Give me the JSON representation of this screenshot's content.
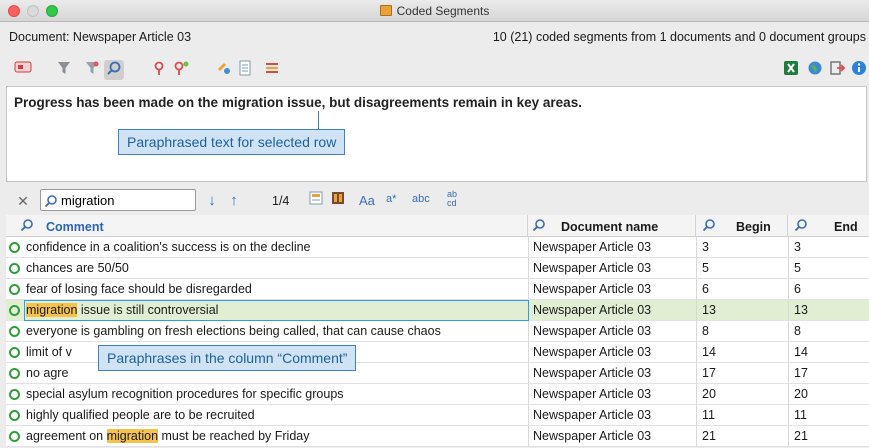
{
  "window": {
    "title": "Coded Segments"
  },
  "document_label": "Document: Newspaper Article 03",
  "segments_summary": "10 (21) coded segments from 1 documents and 0 document groups",
  "preview_text": "Progress has been made on the migration issue, but disagreements remain in key areas.",
  "callouts": {
    "top": "Paraphrased text for selected row",
    "bottom": "Paraphrases in the column “Comment”"
  },
  "search": {
    "value": "migration",
    "position": "1/4",
    "match_case": "Aa",
    "wildcard": "a*",
    "whole_word": "abc",
    "replace": "ab cd"
  },
  "columns": {
    "comment": "Comment",
    "document": "Document name",
    "begin": "Begin",
    "end": "End"
  },
  "rows": [
    {
      "comment": "confidence in a coalition's success is on the decline",
      "document": "Newspaper Article 03",
      "begin": "3",
      "end": "3"
    },
    {
      "comment": "chances are 50/50",
      "document": "Newspaper Article 03",
      "begin": "5",
      "end": "5"
    },
    {
      "comment": "fear of losing face should be disregarded",
      "document": "Newspaper Article 03",
      "begin": "6",
      "end": "6"
    },
    {
      "comment_hl": "migration",
      "comment_after": " issue is still controversial",
      "document": "Newspaper Article 03",
      "begin": "13",
      "end": "13"
    },
    {
      "comment": "everyone is gambling on fresh elections being called, that can cause chaos",
      "document": "Newspaper Article 03",
      "begin": "8",
      "end": "8"
    },
    {
      "comment": "limit of v",
      "document": "Newspaper Article 03",
      "begin": "14",
      "end": "14"
    },
    {
      "comment": "no agre",
      "document": "Newspaper Article 03",
      "begin": "17",
      "end": "17"
    },
    {
      "comment": "special asylum recognition procedures for specific groups",
      "document": "Newspaper Article 03",
      "begin": "20",
      "end": "20"
    },
    {
      "comment": "highly qualified people are to be recruited",
      "document": "Newspaper Article 03",
      "begin": "11",
      "end": "11"
    },
    {
      "comment_before": "agreement on ",
      "comment_hl": "migration",
      "comment_after": " must be reached by Friday",
      "document": "Newspaper Article 03",
      "begin": "21",
      "end": "21"
    }
  ]
}
